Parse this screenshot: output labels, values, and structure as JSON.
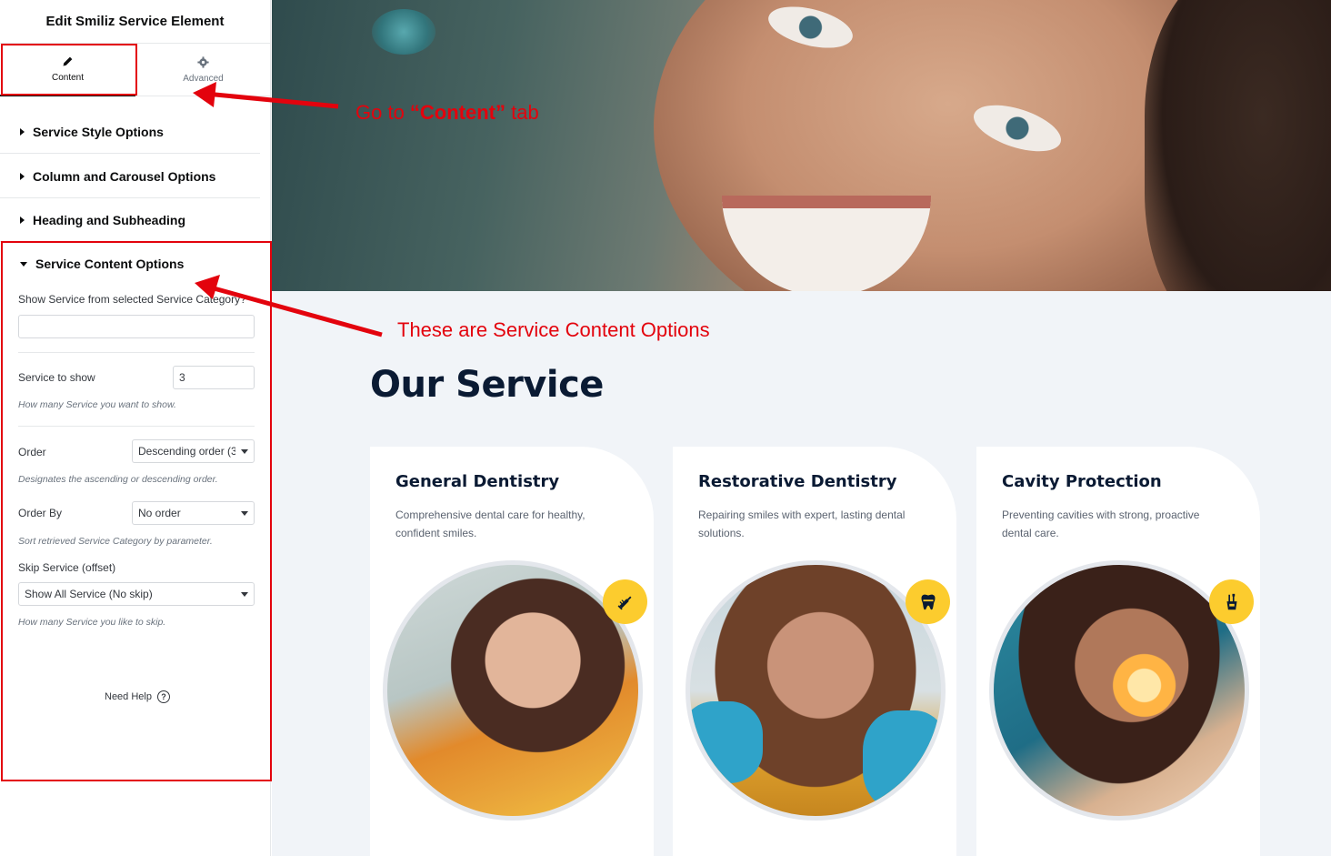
{
  "panel": {
    "title": "Edit Smiliz Service Element",
    "tabs": [
      {
        "label": "Content",
        "icon": "pencil-icon",
        "active": true
      },
      {
        "label": "Advanced",
        "icon": "gear-icon",
        "active": false
      }
    ],
    "sections": [
      {
        "label": "Service Style Options",
        "open": false
      },
      {
        "label": "Column and Carousel Options",
        "open": false
      },
      {
        "label": "Heading and Subheading",
        "open": false
      },
      {
        "label": "Service Content Options",
        "open": true
      }
    ],
    "content_options": {
      "category_label": "Show Service from selected Service Category?",
      "category_value": "",
      "service_to_show_label": "Service to show",
      "service_to_show_value": "3",
      "service_to_show_help": "How many Service you want to show.",
      "order_label": "Order",
      "order_value": "Descending order (3",
      "order_help": "Designates the ascending or descending order.",
      "order_by_label": "Order By",
      "order_by_value": "No order",
      "order_by_help": "Sort retrieved Service Category by parameter.",
      "skip_label": "Skip Service (offset)",
      "skip_value": "Show All Service (No skip)",
      "skip_help": "How many Service you like to skip."
    },
    "need_help": "Need Help",
    "help_glyph": "?",
    "collapse_glyph": "‹"
  },
  "annotations": {
    "tab_note_prefix": "Go  to ",
    "tab_note_bold": "“Content”",
    "tab_note_suffix": " tab",
    "content_note": "These are Service Content Options",
    "color": "#e3030d"
  },
  "preview": {
    "heading": "Our Service",
    "cards": [
      {
        "title": "General Dentistry",
        "description": "Comprehensive dental care for healthy, confident smiles.",
        "badge_icon": "syringe-icon"
      },
      {
        "title": "Restorative Dentistry",
        "description": "Repairing smiles with expert, lasting dental solutions.",
        "badge_icon": "tooth-icon"
      },
      {
        "title": "Cavity Protection",
        "description": "Preventing cavities with strong, proactive dental care.",
        "badge_icon": "toothbrush-cup-icon"
      }
    ],
    "colors": {
      "background": "#f1f4f8",
      "heading": "#0a1a33",
      "badge": "#fccc2e"
    }
  }
}
